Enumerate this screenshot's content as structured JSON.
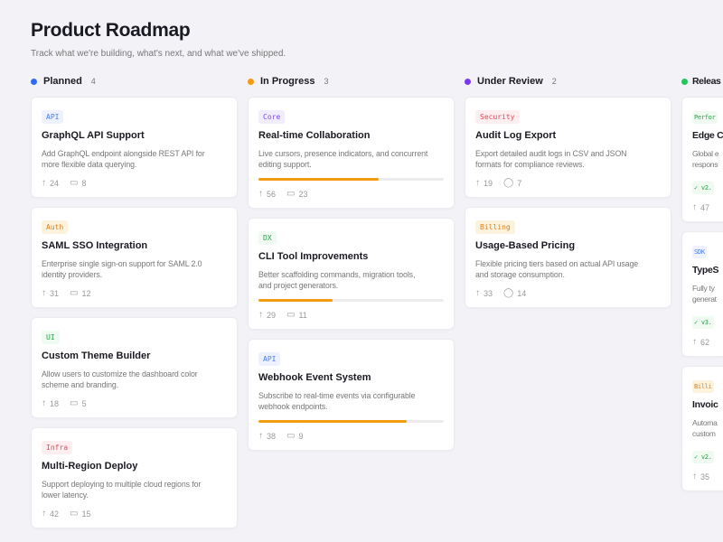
{
  "header": {
    "title": "Product Roadmap",
    "subtitle": "Track what we're building, what's next, and what we've shipped."
  },
  "columns": [
    {
      "name": "Planned",
      "count": "4",
      "color": "#2f6cf0",
      "cards": [
        {
          "tag": "API",
          "tag_color": "#4a7cf0",
          "tag_bg": "#eef2fe",
          "title": "GraphQL API Support",
          "desc": [
            "Add GraphQL endpoint alongside REST API for",
            "more flexible data querying."
          ],
          "votes": "24",
          "comments": "8"
        },
        {
          "tag": "Auth",
          "tag_color": "#d9822b",
          "tag_bg": "#fdf3dc",
          "title": "SAML SSO Integration",
          "desc": [
            "Enterprise single sign-on support for SAML 2.0",
            "identity providers."
          ],
          "votes": "31",
          "comments": "12"
        },
        {
          "tag": "UI",
          "tag_color": "#2ba24c",
          "tag_bg": "#effaf1",
          "title": "Custom Theme Builder",
          "desc": [
            "Allow users to customize the dashboard color",
            "scheme and branding."
          ],
          "votes": "18",
          "comments": "5"
        },
        {
          "tag": "Infra",
          "tag_color": "#e04b5a",
          "tag_bg": "#fdeef0",
          "title": "Multi-Region Deploy",
          "desc": [
            "Support deploying to multiple cloud regions for",
            "lower latency."
          ],
          "votes": "42",
          "comments": "15"
        }
      ]
    },
    {
      "name": "In Progress",
      "count": "3",
      "color": "#f39c12",
      "cards": [
        {
          "tag": "Core",
          "tag_color": "#7c4be8",
          "tag_bg": "#f2edfd",
          "title": "Real-time Collaboration",
          "desc": [
            "Live cursors, presence indicators, and concurrent",
            "editing support."
          ],
          "progress": 0.65,
          "votes": "56",
          "comments": "23"
        },
        {
          "tag": "DX",
          "tag_color": "#2ba24c",
          "tag_bg": "#effaf1",
          "title": "CLI Tool Improvements",
          "desc": [
            "Better scaffolding commands, migration tools,",
            "and project generators."
          ],
          "progress": 0.4,
          "votes": "29",
          "comments": "11"
        },
        {
          "tag": "API",
          "tag_color": "#4a7cf0",
          "tag_bg": "#eef2fe",
          "title": "Webhook Event System",
          "desc": [
            "Subscribe to real-time events via configurable",
            "webhook endpoints."
          ],
          "progress": 0.8,
          "votes": "38",
          "comments": "9"
        }
      ]
    },
    {
      "name": "Under Review",
      "count": "2",
      "color": "#7c3aed",
      "cards": [
        {
          "tag": "Security",
          "tag_color": "#e04b5a",
          "tag_bg": "#fdeef0",
          "title": "Audit Log Export",
          "desc": [
            "Export detailed audit logs in CSV and JSON",
            "formats for compliance reviews."
          ],
          "votes": "19",
          "comments": "7"
        },
        {
          "tag": "Billing",
          "tag_color": "#d9822b",
          "tag_bg": "#fdf3dc",
          "title": "Usage-Based Pricing",
          "desc": [
            "Flexible pricing tiers based on actual API usage",
            "and storage consumption."
          ],
          "votes": "33",
          "comments": "14"
        }
      ]
    },
    {
      "name": "Releas",
      "count": "",
      "color": "#22c55e",
      "cards": [
        {
          "tag": "Perfor",
          "tag_color": "#2ba24c",
          "tag_bg": "#effaf1",
          "title": "Edge C",
          "desc": [
            "Global e",
            "respons"
          ],
          "release": "✓ v2.",
          "votes": "47"
        },
        {
          "tag": "SDK",
          "tag_color": "#4a7cf0",
          "tag_bg": "#eef2fe",
          "title": "TypeS",
          "desc": [
            "Fully ty",
            "generat"
          ],
          "release": "✓ v3.",
          "votes": "62"
        },
        {
          "tag": "Billi",
          "tag_color": "#d9822b",
          "tag_bg": "#fdf3dc",
          "title": "Invoic",
          "desc": [
            "Automa",
            "custom"
          ],
          "release": "✓ v2.",
          "votes": "35"
        }
      ]
    }
  ]
}
